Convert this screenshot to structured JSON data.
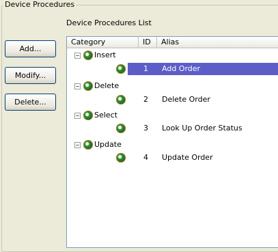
{
  "group": {
    "title": "Device Procedures"
  },
  "list": {
    "title": "Device Procedures List"
  },
  "buttons": {
    "add": "Add...",
    "modify": "Modify...",
    "delete": "Delete..."
  },
  "columns": {
    "category": "Category",
    "id": "ID",
    "alias": "Alias"
  },
  "tree": {
    "expander_glyph": "−",
    "categories": [
      {
        "label": "Insert",
        "item_id": "1",
        "item_alias": "Add Order",
        "selected": true
      },
      {
        "label": "Delete",
        "item_id": "2",
        "item_alias": "Delete Order"
      },
      {
        "label": "Select",
        "item_id": "3",
        "item_alias": "Look Up Order Status"
      },
      {
        "label": "Update",
        "item_id": "4",
        "item_alias": "Update Order"
      }
    ]
  },
  "colors": {
    "selection": "#5d5dc8",
    "groupbox_border": "#c8c5b4"
  },
  "icons": {
    "procedure": "gear-icon"
  }
}
